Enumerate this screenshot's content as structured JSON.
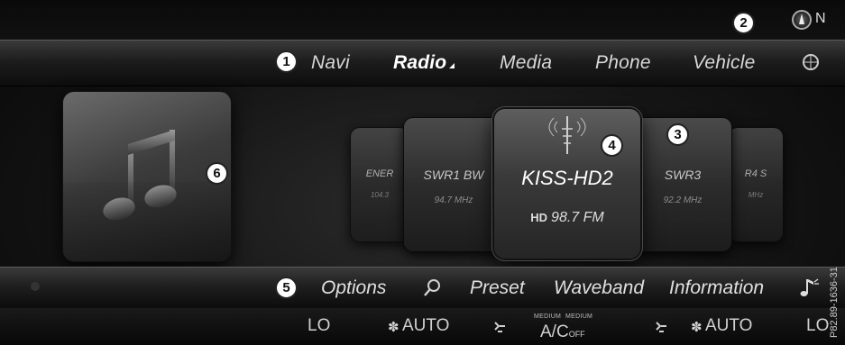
{
  "status": {
    "compass_direction": "N"
  },
  "menu": {
    "items": [
      {
        "label": "Navi",
        "active": false
      },
      {
        "label": "Radio",
        "active": true
      },
      {
        "label": "Media",
        "active": false
      },
      {
        "label": "Phone",
        "active": false
      },
      {
        "label": "Vehicle",
        "active": false
      }
    ],
    "globe_icon": "globe-icon"
  },
  "stations": {
    "far_left": {
      "name": "ENER",
      "freq": "104.3"
    },
    "left": {
      "name": "SWR1 BW",
      "freq": "94.7 MHz"
    },
    "current": {
      "name": "KISS-HD2",
      "hd_label": "HD",
      "freq": "98.7 FM"
    },
    "right": {
      "name": "SWR3",
      "freq": "92.2 MHz"
    },
    "far_right": {
      "name": "R4 S",
      "freq": "MHz"
    }
  },
  "bottom_menu": {
    "options_label": "Options",
    "preset_label": "Preset",
    "waveband_label": "Waveband",
    "information_label": "Information"
  },
  "climate": {
    "left_temp": "LO",
    "left_fan": "AUTO",
    "ac_label": "A/C",
    "ac_state": "OFF",
    "medium_left": "MEDIUM",
    "medium_right": "MEDIUM",
    "right_fan": "AUTO",
    "right_temp": "LO"
  },
  "callouts": [
    "1",
    "2",
    "3",
    "4",
    "5",
    "6"
  ],
  "reference_code": "P82.89-1636-31"
}
